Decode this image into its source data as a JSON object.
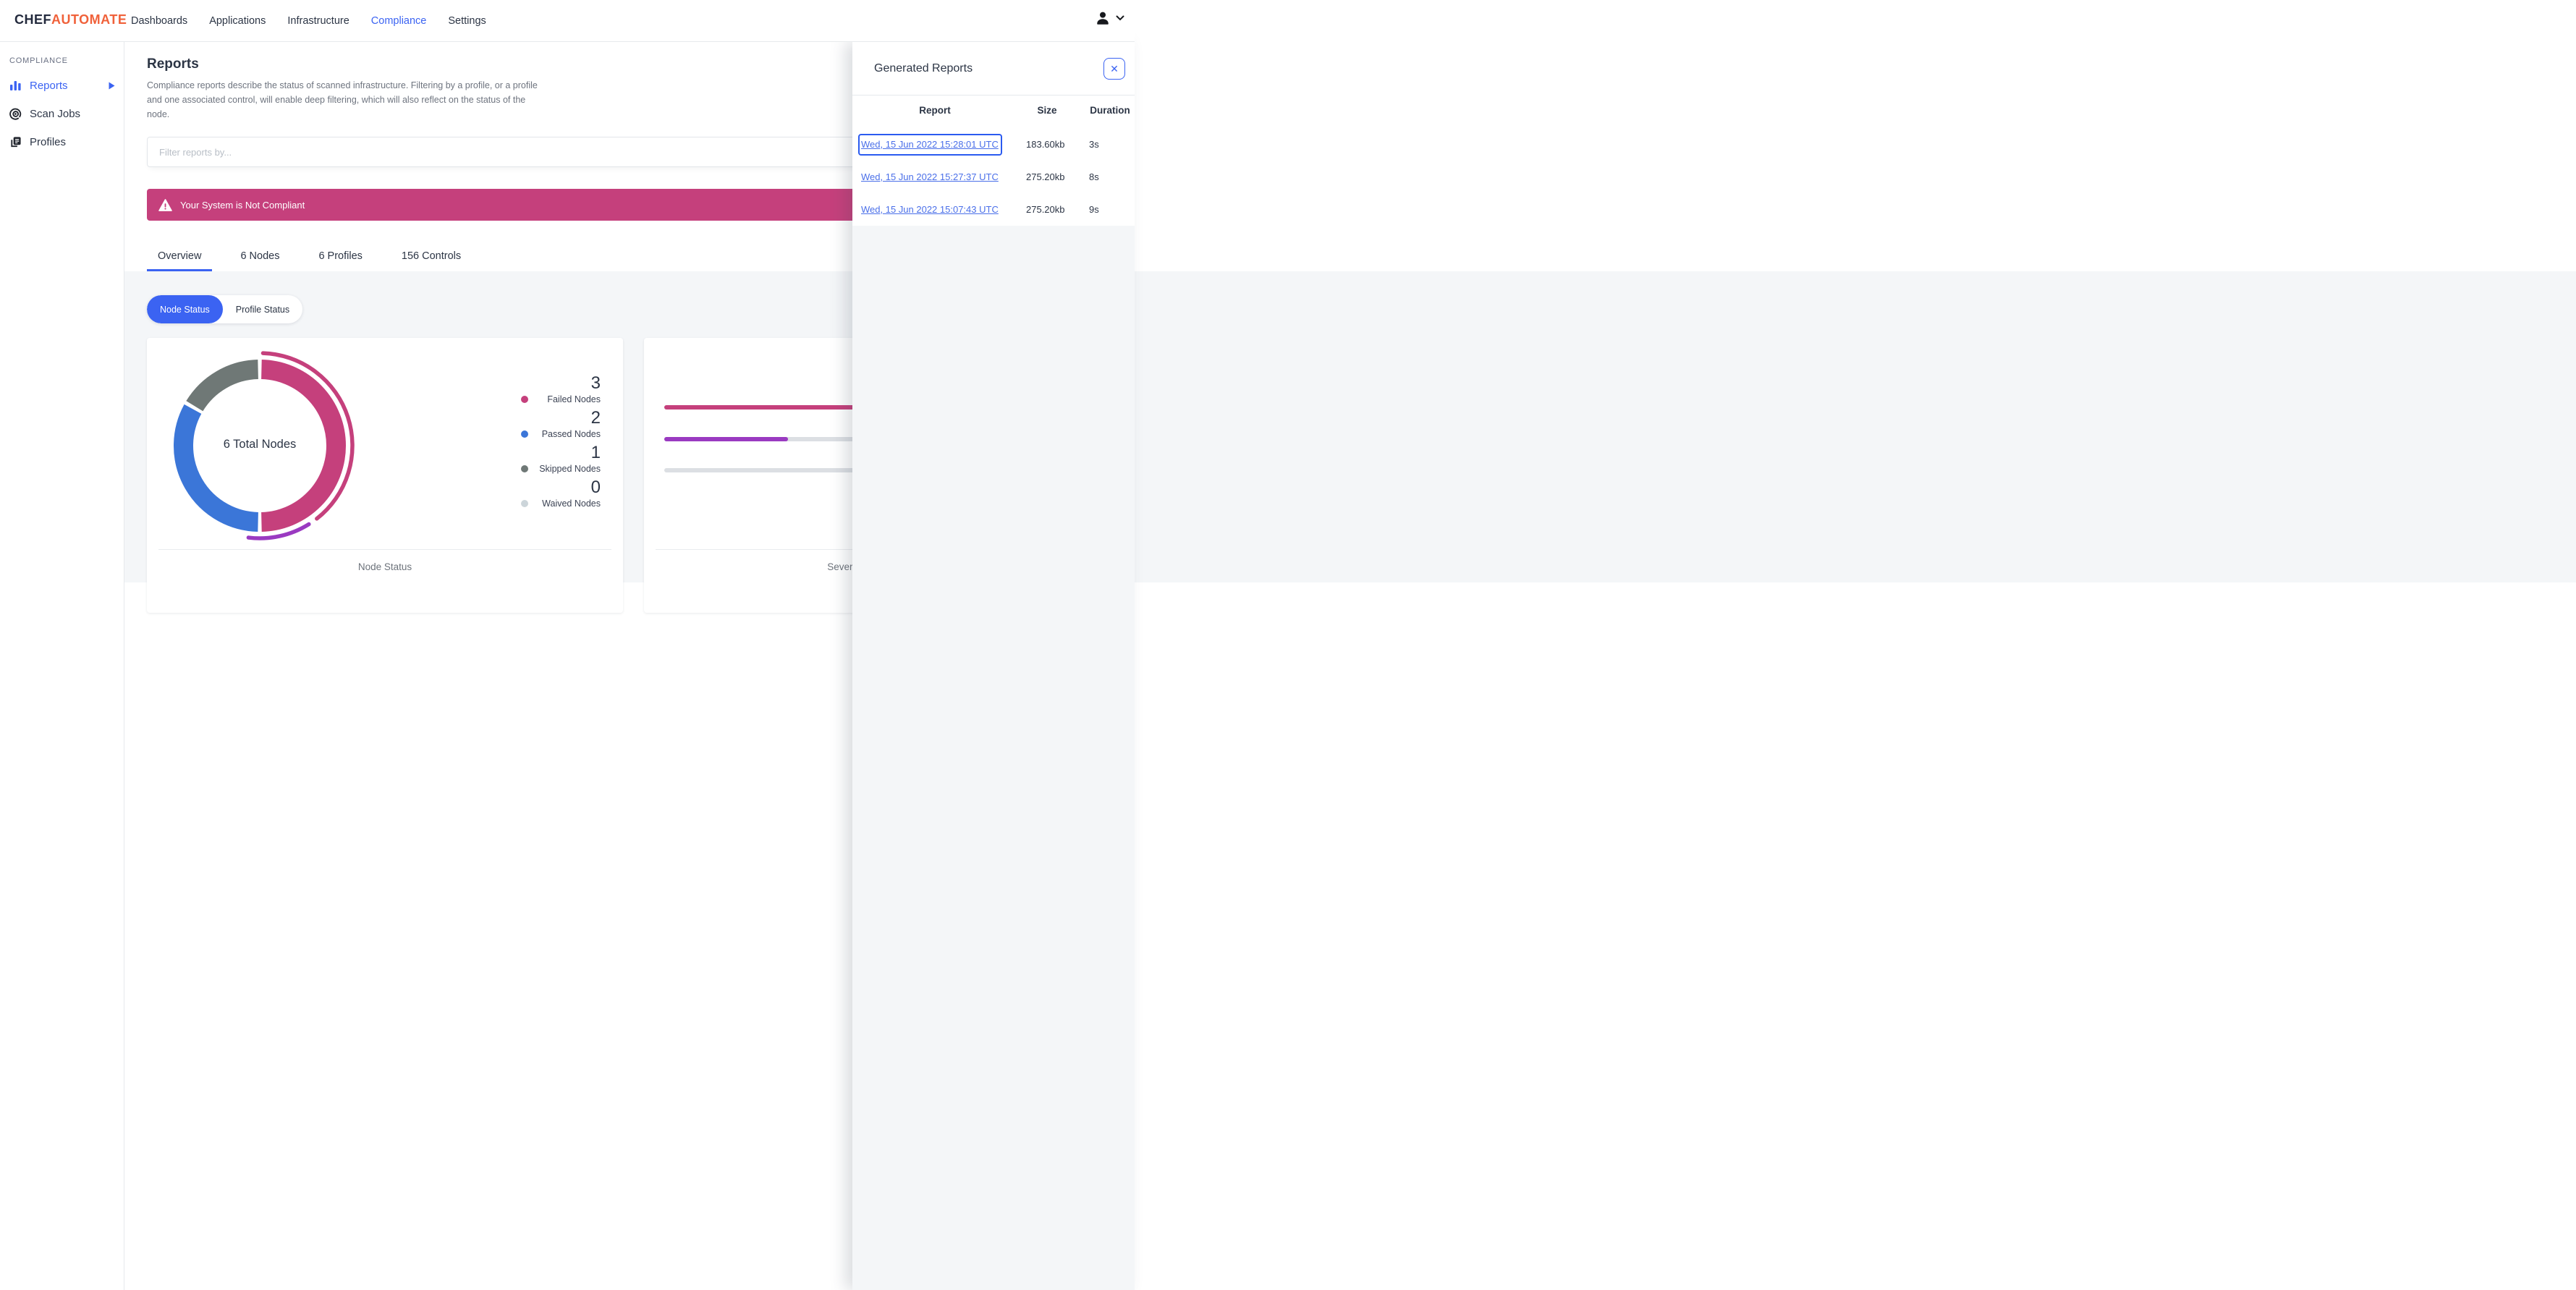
{
  "colors": {
    "accent_blue": "#3b63f2",
    "link_blue": "#4a6fe9",
    "brand_orange": "#f0613a",
    "alert_pink": "#c5407c",
    "chart_failed_pink": "#c5407c",
    "chart_passed_blue": "#3b76d8",
    "chart_skipped_gray": "#6f7876",
    "chart_waived_gray": "#ccd5da",
    "chart_purple": "#9a3ac1",
    "track_gray": "#dcdfe3"
  },
  "icons": {
    "close": "✕"
  },
  "navbar": {
    "brand": {
      "chef": "CHEF",
      "automate": "AUTOMATE"
    },
    "items": [
      {
        "label": "Dashboards"
      },
      {
        "label": "Applications"
      },
      {
        "label": "Infrastructure"
      },
      {
        "label": "Compliance"
      },
      {
        "label": "Settings"
      }
    ],
    "active": "Compliance"
  },
  "sidebar": {
    "section": "COMPLIANCE",
    "items": [
      {
        "label": "Reports",
        "active": true
      },
      {
        "label": "Scan Jobs",
        "active": false
      },
      {
        "label": "Profiles",
        "active": false
      }
    ]
  },
  "page": {
    "title": "Reports",
    "description": "Compliance reports describe the status of scanned infrastructure. Filtering by a profile, or a profile and one associated control, will enable deep filtering, which will also reflect on the status of the node.",
    "filter_placeholder": "Filter reports by...",
    "alert": "Your System is Not Compliant"
  },
  "tabs": [
    {
      "label": "Overview",
      "active": true
    },
    {
      "label": "6 Nodes",
      "active": false
    },
    {
      "label": "6 Profiles",
      "active": false
    },
    {
      "label": "156 Controls",
      "active": false
    }
  ],
  "toggle": {
    "options": [
      "Node Status",
      "Profile Status"
    ],
    "active": "Node Status"
  },
  "chart_data": [
    {
      "type": "donut",
      "title": "Node Status",
      "center_label": "6 Total Nodes",
      "total": 6,
      "slices": [
        {
          "label": "Failed Nodes",
          "value": 3,
          "color": "#c5407c"
        },
        {
          "label": "Passed Nodes",
          "value": 2,
          "color": "#3b76d8"
        },
        {
          "label": "Skipped Nodes",
          "value": 1,
          "color": "#6f7876"
        },
        {
          "label": "Waived Nodes",
          "value": 0,
          "color": "#ccd5da"
        }
      ],
      "outer_arcs": [
        {
          "color": "#c5407c",
          "start_deg": 2,
          "end_deg": 142
        },
        {
          "color": "#9a3ac1",
          "start_deg": 148,
          "end_deg": 187
        }
      ],
      "legend_position": "right"
    },
    {
      "type": "bar",
      "title": "Severity of Node Failures",
      "track_color": "#dcdfe3",
      "bars": [
        {
          "color": "#c5407c",
          "percent": 100
        },
        {
          "color": "#9a3ac1",
          "percent": 28
        },
        {
          "color": null,
          "percent": 0
        }
      ]
    }
  ],
  "generated_reports": {
    "title": "Generated Reports",
    "columns": [
      "Report",
      "Size",
      "Duration"
    ],
    "rows": [
      {
        "report": "Wed, 15 Jun 2022 15:28:01 UTC",
        "size": "183.60kb",
        "duration": "3s",
        "focused": true
      },
      {
        "report": "Wed, 15 Jun 2022 15:27:37 UTC",
        "size": "275.20kb",
        "duration": "8s",
        "focused": false
      },
      {
        "report": "Wed, 15 Jun 2022 15:07:43 UTC",
        "size": "275.20kb",
        "duration": "9s",
        "focused": false
      }
    ]
  }
}
